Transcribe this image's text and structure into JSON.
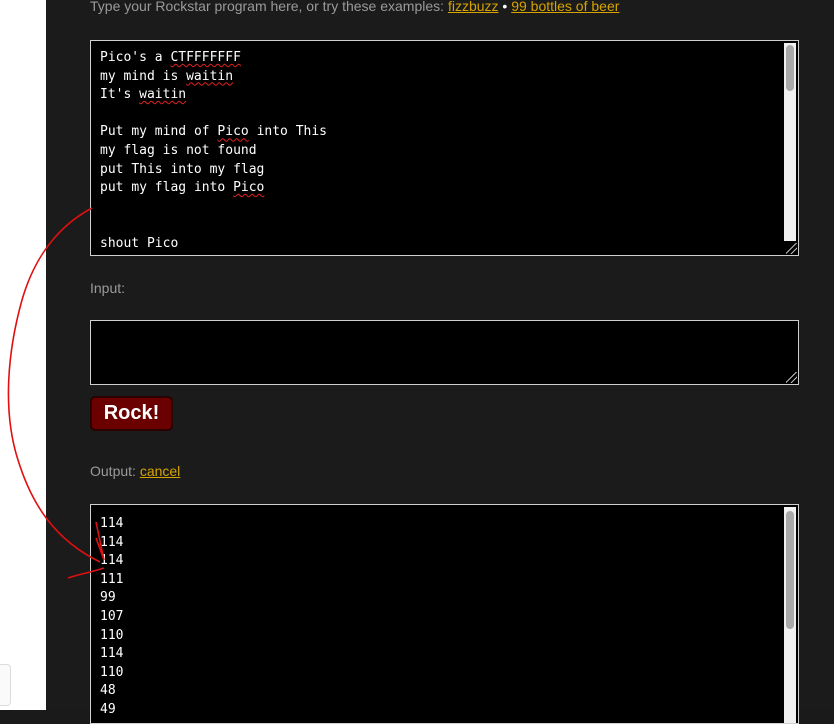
{
  "intro": {
    "text": "Type your Rockstar program here, or try these examples: ",
    "example1": "fizzbuzz",
    "separator": " • ",
    "example2": "99 bottles of beer"
  },
  "program": {
    "lines": [
      "Pico's a CTFFFFFFF",
      "my mind is waitin",
      "It's waitin",
      "",
      "Put my mind of Pico into This",
      "my flag is not found",
      "put This into my flag",
      "put my flag into Pico",
      "",
      "",
      "shout Pico"
    ]
  },
  "input": {
    "label": "Input:",
    "value": ""
  },
  "run_button": {
    "label": "Rock!"
  },
  "output": {
    "label": "Output: ",
    "cancel_link": "cancel",
    "lines": [
      "114",
      "114",
      "114",
      "111",
      "99",
      "107",
      "110",
      "114",
      "110",
      "48",
      "49"
    ]
  },
  "colors": {
    "accent_link": "#d6a300",
    "button_bg": "#6b0000",
    "annotation": "#e01010"
  }
}
